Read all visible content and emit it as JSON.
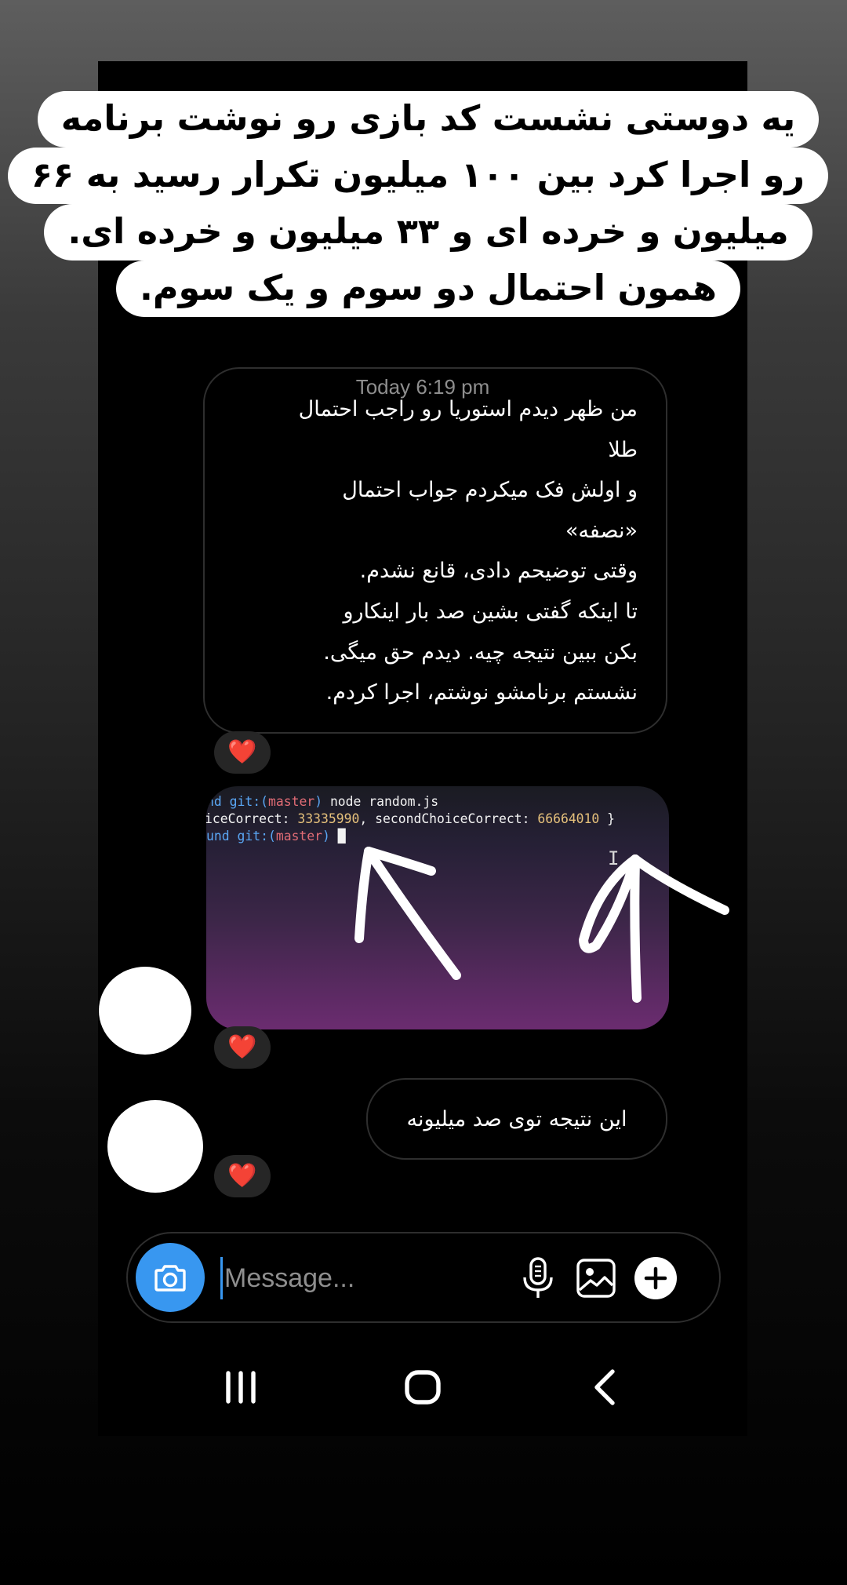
{
  "caption": {
    "lines": [
      "یه دوستی نشست کد بازی رو نوشت برنامه",
      "رو اجرا کرد بین ۱۰۰ میلیون تکرار رسید به ۶۶",
      "میلیون و خرده ای و ۳۳ میلیون و خرده ای.",
      "همون احتمال دو سوم و یک سوم."
    ]
  },
  "thread": {
    "timestamp": "Today 6:19 pm",
    "message_1": {
      "lines": [
        "من ظهر دیدم استوریا رو راجب احتمال",
        "طلا",
        "و اولش فک میکردم جواب احتمال",
        "«نصفه»",
        "وقتی توضیحم دادی، قانع نشدم.",
        "تا اینکه گفتی بشین صد بار اینکارو",
        "بکن ببین نتیجه چیه. دیدم حق میگی.",
        "نشستم برنامشو نوشتم، اجرا کردم."
      ],
      "reaction": "❤️"
    },
    "screenshot": {
      "line1": {
        "prefix": "nd",
        "git": "git:(",
        "branch": "master",
        "close": ")",
        "cmd": "node random.js"
      },
      "line2": {
        "label1": "iceCorrect: ",
        "value1": "33335990",
        "label2": ", secondChoiceCorrect: ",
        "value2": "66664010",
        "end": " }"
      },
      "line3": {
        "prefix": "und",
        "git": "git:(",
        "branch": "master",
        "close": ")",
        "cursor": "█"
      },
      "ibeam": "I",
      "reaction": "❤️"
    },
    "message_2": {
      "text": "این نتیجه توی صد میلیونه",
      "reaction": "❤️"
    }
  },
  "composer": {
    "placeholder": "Message...",
    "value": ""
  },
  "colors": {
    "accent": "#3897f0",
    "heart": "#ff2e4c",
    "bubble_border": "#2e2e2e"
  },
  "icons": [
    "camera-icon",
    "microphone-icon",
    "gallery-icon",
    "plus-icon",
    "recent-apps-icon",
    "home-icon",
    "back-icon"
  ]
}
